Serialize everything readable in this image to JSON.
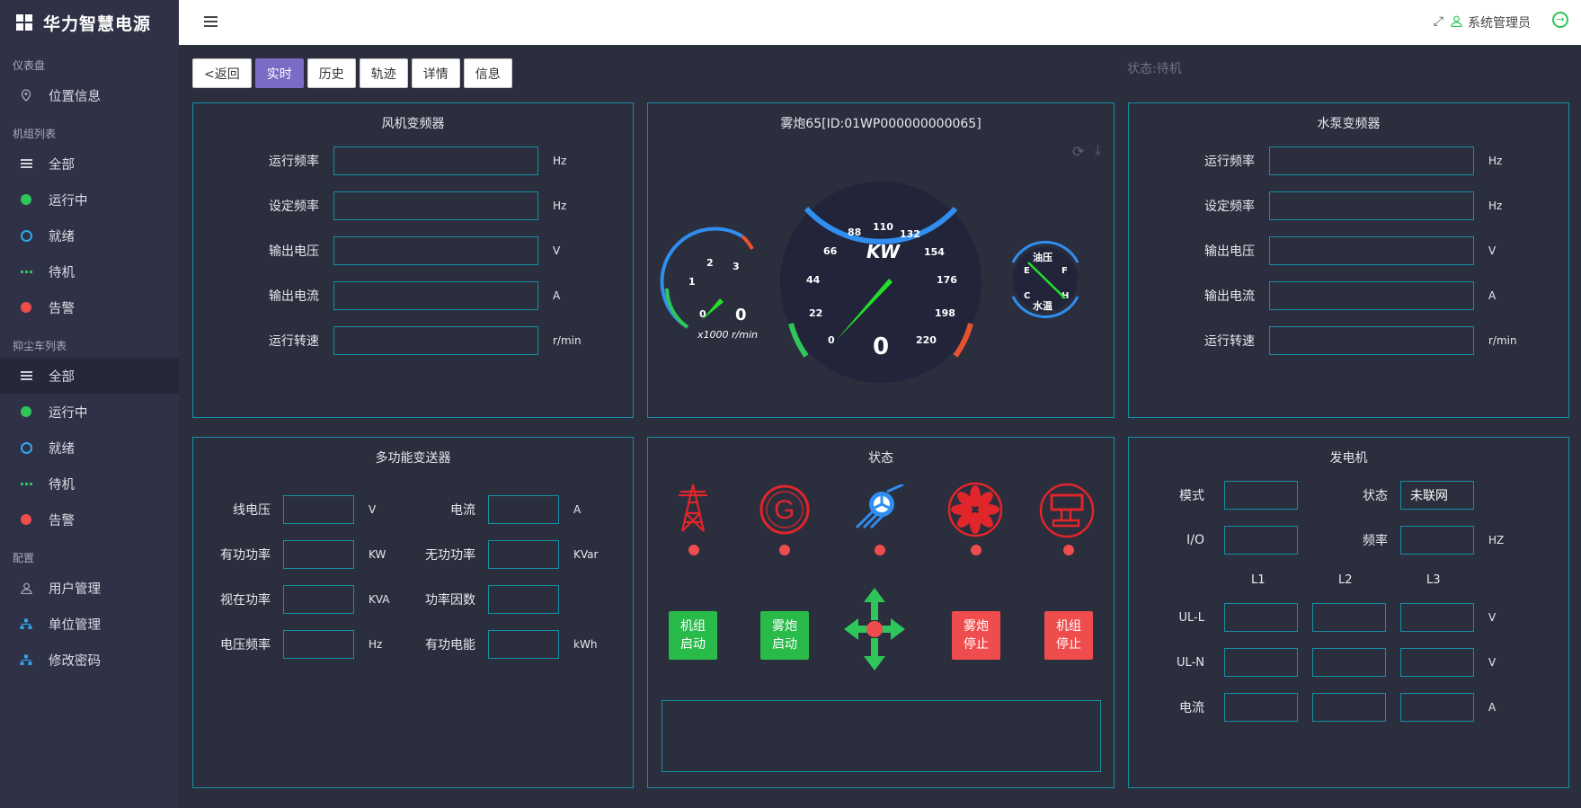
{
  "app": {
    "title": "华力智慧电源"
  },
  "sidebar": {
    "sections": [
      {
        "title": "仪表盘",
        "items": [
          {
            "label": "位置信息",
            "icon": "map-pin-icon"
          }
        ]
      },
      {
        "title": "机组列表",
        "items": [
          {
            "label": "全部",
            "icon": "list-icon"
          },
          {
            "label": "运行中",
            "icon": "green-dot-icon"
          },
          {
            "label": "就绪",
            "icon": "blue-ring-icon"
          },
          {
            "label": "待机",
            "icon": "green-dashes-icon"
          },
          {
            "label": "告警",
            "icon": "red-dot-icon"
          }
        ]
      },
      {
        "title": "抑尘车列表",
        "items": [
          {
            "label": "全部",
            "icon": "list-icon",
            "active": true
          },
          {
            "label": "运行中",
            "icon": "green-dot-icon"
          },
          {
            "label": "就绪",
            "icon": "blue-ring-icon"
          },
          {
            "label": "待机",
            "icon": "green-dashes-icon"
          },
          {
            "label": "告警",
            "icon": "red-dot-icon"
          }
        ]
      },
      {
        "title": "配置",
        "items": [
          {
            "label": "用户管理",
            "icon": "user-icon"
          },
          {
            "label": "单位管理",
            "icon": "org-chart-icon"
          },
          {
            "label": "修改密码",
            "icon": "org-chart-icon"
          }
        ]
      }
    ]
  },
  "header": {
    "user": "系统管理员",
    "fullscreen_icon": "expand-icon",
    "logout_icon": "power-icon"
  },
  "tabs": [
    {
      "label": "<返回"
    },
    {
      "label": "实时",
      "active": true
    },
    {
      "label": "历史"
    },
    {
      "label": "轨迹"
    },
    {
      "label": "详情"
    },
    {
      "label": "信息"
    }
  ],
  "status_text": "状态:待机",
  "fan_inverter": {
    "title": "风机变频器",
    "fields": [
      {
        "label": "运行频率",
        "value": "",
        "unit": "Hz"
      },
      {
        "label": "设定频率",
        "value": "",
        "unit": "Hz"
      },
      {
        "label": "输出电压",
        "value": "",
        "unit": "V"
      },
      {
        "label": "输出电流",
        "value": "",
        "unit": "A"
      },
      {
        "label": "运行转速",
        "value": "",
        "unit": "r/min"
      }
    ]
  },
  "gauge": {
    "title": "雾炮65[ID:01WP000000000065]",
    "rpm": {
      "value": "0",
      "unit_label": "x1000 r/min",
      "ticks": [
        "0",
        "1",
        "2",
        "3"
      ]
    },
    "power": {
      "value": "0",
      "unit_label": "KW",
      "ticks": [
        "0",
        "22",
        "44",
        "66",
        "88",
        "110",
        "132",
        "154",
        "176",
        "198",
        "220"
      ]
    },
    "fuel": {
      "oil_label": "油压",
      "water_label": "水温",
      "e": "E",
      "f": "F",
      "c": "C",
      "h": "H"
    },
    "colors": {
      "needle": "#22e02a",
      "arc_blue": "#2f8ef0",
      "arc_red": "#e8522e",
      "arc_green": "#2ec55a"
    }
  },
  "pump_inverter": {
    "title": "水泵变频器",
    "fields": [
      {
        "label": "运行频率",
        "value": "",
        "unit": "Hz"
      },
      {
        "label": "设定频率",
        "value": "",
        "unit": "Hz"
      },
      {
        "label": "输出电压",
        "value": "",
        "unit": "V"
      },
      {
        "label": "输出电流",
        "value": "",
        "unit": "A"
      },
      {
        "label": "运行转速",
        "value": "",
        "unit": "r/min"
      }
    ]
  },
  "transmitter": {
    "title": "多功能变送器",
    "left": [
      {
        "label": "线电压",
        "value": "",
        "unit": "V"
      },
      {
        "label": "有功功率",
        "value": "",
        "unit": "KW"
      },
      {
        "label": "视在功率",
        "value": "",
        "unit": "KVA"
      },
      {
        "label": "电压频率",
        "value": "",
        "unit": "Hz"
      }
    ],
    "right": [
      {
        "label": "电流",
        "value": "",
        "unit": "A"
      },
      {
        "label": "无功功率",
        "value": "",
        "unit": "KVar"
      },
      {
        "label": "功率因数",
        "value": "",
        "unit": ""
      },
      {
        "label": "有功电能",
        "value": "",
        "unit": "kWh"
      }
    ]
  },
  "status_panel": {
    "title": "状态",
    "icons": [
      {
        "name": "power-tower-icon",
        "state": "red"
      },
      {
        "name": "generator-icon",
        "state": "red"
      },
      {
        "name": "fan-icon",
        "state": "blue"
      },
      {
        "name": "fan-icon",
        "state": "red"
      },
      {
        "name": "spray-cannon-icon",
        "state": "red"
      }
    ],
    "buttons": {
      "unit_start": "机组启动",
      "fog_start": "雾炮启动",
      "fog_stop": "雾炮停止",
      "unit_stop": "机组停止"
    },
    "direction_icon": "move-arrows-icon",
    "message": ""
  },
  "generator": {
    "title": "发电机",
    "mode_label": "模式",
    "mode_value": "",
    "state_label": "状态",
    "state_value": "未联网",
    "io_label": "I/O",
    "io_value": "",
    "freq_label": "频率",
    "freq_value": "",
    "freq_unit": "HZ",
    "columns": [
      "L1",
      "L2",
      "L3"
    ],
    "rows": [
      {
        "label": "UL-L",
        "values": [
          "",
          "",
          ""
        ],
        "unit": "V"
      },
      {
        "label": "UL-N",
        "values": [
          "",
          "",
          ""
        ],
        "unit": "V"
      },
      {
        "label": "电流",
        "values": [
          "",
          "",
          ""
        ],
        "unit": "A"
      }
    ]
  }
}
